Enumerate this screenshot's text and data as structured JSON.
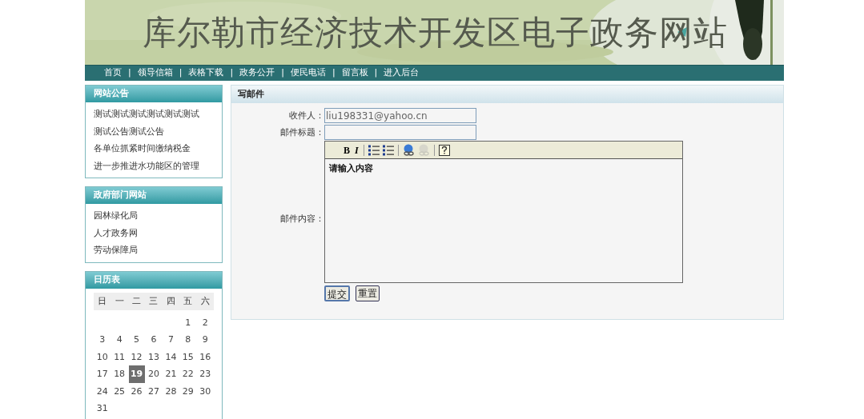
{
  "banner": {
    "title": "库尔勒市经济技术开发区电子政务网站",
    "kind": "picture"
  },
  "nav": {
    "items": [
      "首页",
      "领导信箱",
      "表格下载",
      "政务公开",
      "便民电话",
      "留言板",
      "进入后台"
    ],
    "separator": "|"
  },
  "sidebar": {
    "panels": [
      {
        "title": "网站公告",
        "items": [
          "测试测试测试测试测试测试",
          "测试公告测试公告",
          "各单位抓紧时间缴纳税金",
          "进一步推进水功能区的管理"
        ]
      },
      {
        "title": "政府部门网站",
        "items": [
          "园林绿化局",
          "人才政务网",
          "劳动保障局"
        ]
      }
    ],
    "calendar": {
      "title": "日历表",
      "weekdays": [
        "日",
        "一",
        "二",
        "三",
        "四",
        "五",
        "六"
      ],
      "weeks": [
        [
          {
            "kind": "blank"
          },
          {
            "kind": "blank"
          },
          {
            "kind": "blank"
          },
          {
            "kind": "blank"
          },
          {
            "kind": "blank"
          },
          {
            "kind": "day",
            "label": "1",
            "selected": false
          },
          {
            "kind": "day",
            "label": "2",
            "selected": false
          }
        ],
        [
          {
            "kind": "day",
            "label": "3",
            "selected": false
          },
          {
            "kind": "day",
            "label": "4",
            "selected": false
          },
          {
            "kind": "day",
            "label": "5",
            "selected": false
          },
          {
            "kind": "day",
            "label": "6",
            "selected": false
          },
          {
            "kind": "day",
            "label": "7",
            "selected": false
          },
          {
            "kind": "day",
            "label": "8",
            "selected": false
          },
          {
            "kind": "day",
            "label": "9",
            "selected": false
          }
        ],
        [
          {
            "kind": "day",
            "label": "10",
            "selected": false
          },
          {
            "kind": "day",
            "label": "11",
            "selected": false
          },
          {
            "kind": "day",
            "label": "12",
            "selected": false
          },
          {
            "kind": "day",
            "label": "13",
            "selected": false
          },
          {
            "kind": "day",
            "label": "14",
            "selected": false
          },
          {
            "kind": "day",
            "label": "15",
            "selected": false
          },
          {
            "kind": "day",
            "label": "16",
            "selected": false
          }
        ],
        [
          {
            "kind": "day",
            "label": "17",
            "selected": false
          },
          {
            "kind": "day",
            "label": "18",
            "selected": false
          },
          {
            "kind": "day",
            "label": "19",
            "selected": true
          },
          {
            "kind": "day",
            "label": "20",
            "selected": false
          },
          {
            "kind": "day",
            "label": "21",
            "selected": false
          },
          {
            "kind": "day",
            "label": "22",
            "selected": false
          },
          {
            "kind": "day",
            "label": "23",
            "selected": false
          }
        ],
        [
          {
            "kind": "day",
            "label": "24",
            "selected": false
          },
          {
            "kind": "day",
            "label": "25",
            "selected": false
          },
          {
            "kind": "day",
            "label": "26",
            "selected": false
          },
          {
            "kind": "day",
            "label": "27",
            "selected": false
          },
          {
            "kind": "day",
            "label": "28",
            "selected": false
          },
          {
            "kind": "day",
            "label": "29",
            "selected": false
          },
          {
            "kind": "day",
            "label": "30",
            "selected": false
          }
        ],
        [
          {
            "kind": "day",
            "label": "31",
            "selected": false
          }
        ]
      ]
    }
  },
  "mail_form": {
    "title": "写邮件",
    "recipient": {
      "label": "收件人：",
      "value": "liu198331@yahoo.cn"
    },
    "subject": {
      "label": "邮件标题："
    },
    "content": {
      "label": "邮件内容：",
      "value": "请输入内容",
      "toolbar_groups": [
        [
          {
            "kind": "bold",
            "label": "B",
            "disabled": false
          },
          {
            "kind": "italic",
            "label": "I",
            "disabled": false
          }
        ],
        [
          {
            "kind": "ordered-list",
            "disabled": false
          },
          {
            "kind": "bullet-list",
            "disabled": false
          }
        ],
        [
          {
            "kind": "link",
            "disabled": false
          },
          {
            "kind": "unlink",
            "disabled": true
          }
        ],
        [
          {
            "kind": "help",
            "disabled": false
          }
        ]
      ]
    },
    "buttons": [
      "提交",
      "重置"
    ]
  }
}
